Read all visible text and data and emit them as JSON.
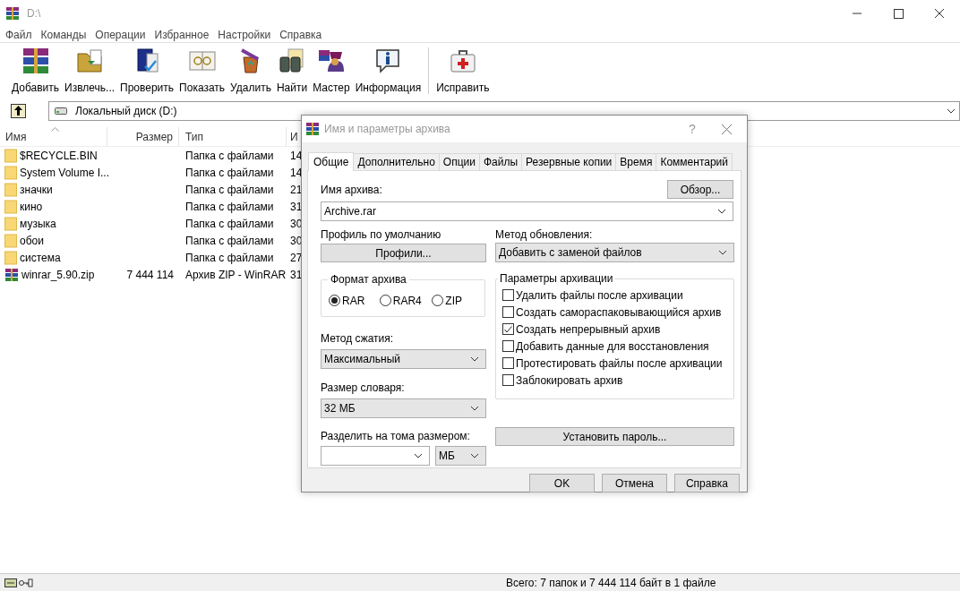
{
  "window": {
    "title": "D:\\"
  },
  "menu": [
    "Файл",
    "Команды",
    "Операции",
    "Избранное",
    "Настройки",
    "Справка"
  ],
  "toolbar": [
    {
      "kind": "add",
      "label": "Добавить"
    },
    {
      "kind": "extract",
      "label": "Извлечь..."
    },
    {
      "kind": "test",
      "label": "Проверить"
    },
    {
      "kind": "view",
      "label": "Показать"
    },
    {
      "kind": "delete",
      "label": "Удалить"
    },
    {
      "kind": "find",
      "label": "Найти"
    },
    {
      "kind": "wizard",
      "label": "Мастер"
    },
    {
      "kind": "info",
      "label": "Информация"
    },
    {
      "kind": "repair",
      "label": "Исправить"
    }
  ],
  "address": {
    "value": "Локальный диск (D:)"
  },
  "file_list": {
    "columns": [
      "Имя",
      "Размер",
      "Тип",
      "И"
    ],
    "rows": [
      {
        "kind": "folder",
        "name": "$RECYCLE.BIN",
        "size": "",
        "type": "Папка с файлами",
        "column_4": "14"
      },
      {
        "kind": "folder",
        "name": "System Volume I...",
        "size": "",
        "type": "Папка с файлами",
        "column_4": "14"
      },
      {
        "kind": "folder",
        "name": "значки",
        "size": "",
        "type": "Папка с файлами",
        "column_4": "21"
      },
      {
        "kind": "folder",
        "name": "кино",
        "size": "",
        "type": "Папка с файлами",
        "column_4": "31"
      },
      {
        "kind": "folder",
        "name": "музыка",
        "size": "",
        "type": "Папка с файлами",
        "column_4": "30"
      },
      {
        "kind": "folder",
        "name": "обои",
        "size": "",
        "type": "Папка с файлами",
        "column_4": "30"
      },
      {
        "kind": "folder",
        "name": "система",
        "size": "",
        "type": "Папка с файлами",
        "column_4": "27"
      },
      {
        "kind": "archive",
        "name": "winrar_5.90.zip",
        "size": "7 444 114",
        "type": "Архив ZIP - WinRAR",
        "column_4": "31"
      }
    ]
  },
  "status_bar": {
    "text": "Всего: 7 папок и 7 444 114 байт в 1 файле"
  },
  "dialog": {
    "title": "Имя и параметры архива",
    "help": "?",
    "tabs": [
      {
        "label": "Общие",
        "selected": true
      },
      {
        "label": "Дополнительно",
        "selected": false
      },
      {
        "label": "Опции",
        "selected": false
      },
      {
        "label": "Файлы",
        "selected": false
      },
      {
        "label": "Резервные копии",
        "selected": false
      },
      {
        "label": "Время",
        "selected": false
      },
      {
        "label": "Комментарий",
        "selected": false
      }
    ],
    "archive_name_label": "Имя архива:",
    "browse_button": "Обзор...",
    "archive_name": "Archive.rar",
    "profile_label": "Профиль по умолчанию",
    "profiles_button": "Профили...",
    "update_method_label": "Метод обновления:",
    "update_method": "Добавить с заменой файлов",
    "format_group": {
      "title": "Формат архива",
      "options": [
        {
          "label": "RAR",
          "selected": true
        },
        {
          "label": "RAR4",
          "selected": false
        },
        {
          "label": "ZIP",
          "selected": false
        }
      ]
    },
    "compression_label": "Метод сжатия:",
    "compression": "Максимальный",
    "dictionary_label": "Размер словаря:",
    "dictionary": "32 МБ",
    "split_label": "Разделить на тома размером:",
    "split_unit": "МБ",
    "options_group": {
      "title": "Параметры архивации",
      "options": [
        {
          "label": "Удалить файлы после архивации",
          "checked": false
        },
        {
          "label": "Создать самораспаковывающийся архив",
          "checked": false
        },
        {
          "label": "Создать непрерывный архив",
          "checked": true
        },
        {
          "label": "Добавить данные для восстановления",
          "checked": false
        },
        {
          "label": "Протестировать файлы после архивации",
          "checked": false
        },
        {
          "label": "Заблокировать архив",
          "checked": false
        }
      ]
    },
    "password_button": "Установить пароль...",
    "buttons": [
      "OK",
      "Отмена",
      "Справка"
    ]
  }
}
